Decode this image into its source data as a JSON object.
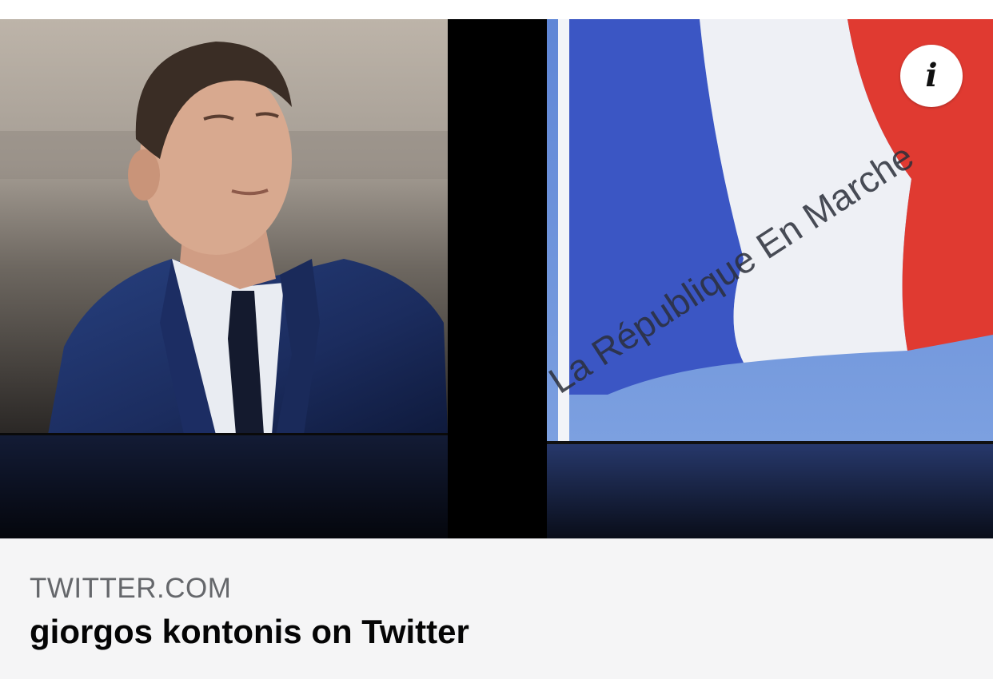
{
  "link_preview": {
    "domain": "TWITTER.COM",
    "title": "giorgos kontonis on Twitter",
    "image": {
      "description": "photo-collage-man-in-suit-and-french-flag",
      "flag_text": "La République En Marche"
    },
    "info_icon": "info-icon"
  },
  "colors": {
    "footer_bg": "#f5f5f6",
    "domain_text": "#65676b",
    "title_text": "#050505",
    "flag_blue": "#3b56c4",
    "flag_white": "#eef0f5",
    "flag_red": "#e03a31"
  }
}
